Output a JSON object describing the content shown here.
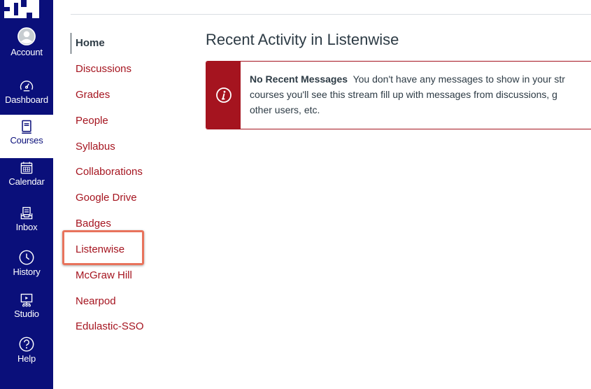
{
  "global_nav": {
    "items": [
      {
        "label": "Account",
        "icon": "account-icon"
      },
      {
        "label": "Dashboard",
        "icon": "dashboard-icon"
      },
      {
        "label": "Courses",
        "icon": "courses-icon"
      },
      {
        "label": "Calendar",
        "icon": "calendar-icon"
      },
      {
        "label": "Inbox",
        "icon": "inbox-icon"
      },
      {
        "label": "History",
        "icon": "history-icon"
      },
      {
        "label": "Studio",
        "icon": "studio-icon"
      },
      {
        "label": "Help",
        "icon": "help-icon"
      }
    ],
    "active": "Courses",
    "bg_color": "#0a0f7a"
  },
  "course_nav": {
    "items": [
      {
        "label": "Home"
      },
      {
        "label": "Discussions"
      },
      {
        "label": "Grades"
      },
      {
        "label": "People"
      },
      {
        "label": "Syllabus"
      },
      {
        "label": "Collaborations"
      },
      {
        "label": "Google Drive"
      },
      {
        "label": "Badges"
      },
      {
        "label": "Listenwise"
      },
      {
        "label": "McGraw Hill"
      },
      {
        "label": "Nearpod"
      },
      {
        "label": "Edulastic-SSO"
      }
    ],
    "current": "Home",
    "highlighted": "Listenwise",
    "link_color": "#a5141f",
    "highlight_color": "#e8735c"
  },
  "main": {
    "title": "Recent Activity in Listenwise",
    "alert": {
      "heading": "No Recent Messages",
      "line1": "You don't have any messages to show in your str",
      "line2": "courses you'll see this stream fill up with messages from discussions, g",
      "line3": "other users, etc.",
      "icon": "info-icon",
      "color": "#a5141f"
    }
  }
}
